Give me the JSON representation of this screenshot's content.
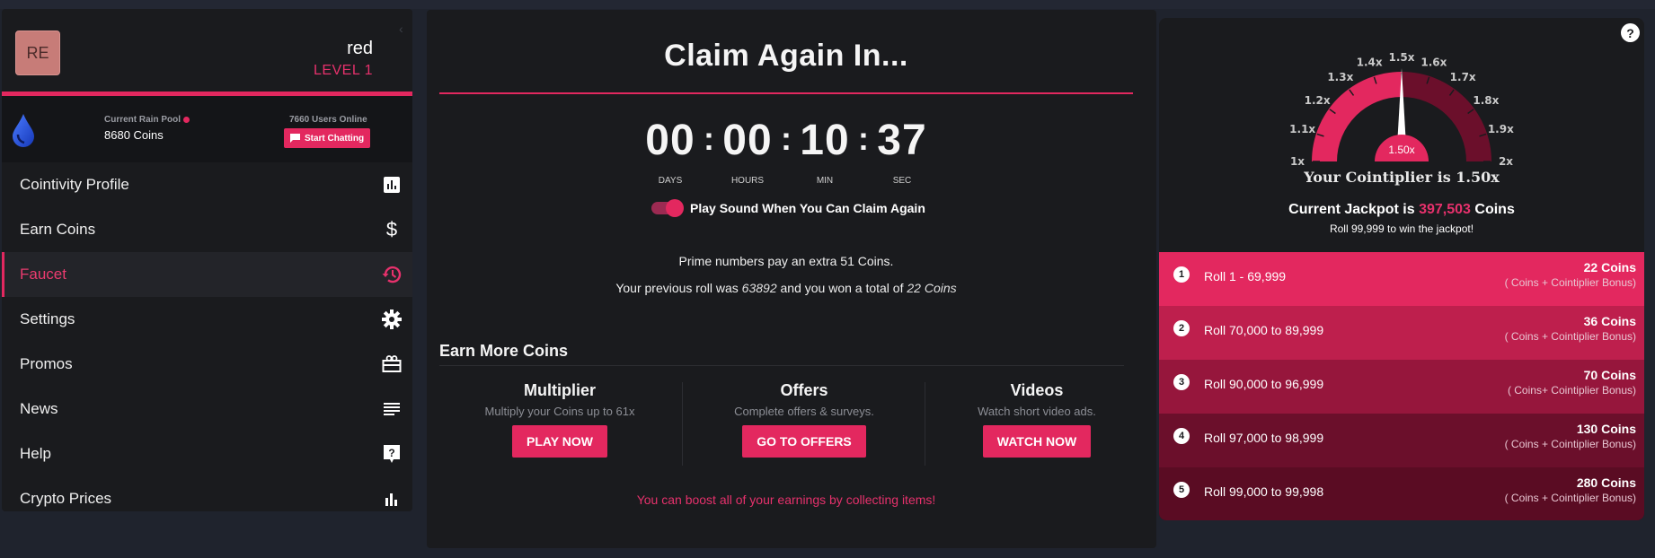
{
  "user": {
    "initials": "RE",
    "name": "red",
    "level": "LEVEL 1"
  },
  "rain": {
    "pool_label": "Current Rain Pool",
    "pool_value": "8680 Coins",
    "online_label": "7660 Users Online",
    "chat_button": "Start Chatting"
  },
  "sidebar": {
    "items": [
      {
        "label": "Cointivity Profile",
        "icon": "bar-chart-icon"
      },
      {
        "label": "Earn Coins",
        "icon": "dollar-icon"
      },
      {
        "label": "Faucet",
        "icon": "history-icon",
        "active": true
      },
      {
        "label": "Settings",
        "icon": "gear-icon"
      },
      {
        "label": "Promos",
        "icon": "gift-icon"
      },
      {
        "label": "News",
        "icon": "news-icon"
      },
      {
        "label": "Help",
        "icon": "help-icon"
      },
      {
        "label": "Crypto Prices",
        "icon": "chart-icon"
      }
    ]
  },
  "claim": {
    "title": "Claim Again In...",
    "timer": {
      "days": "00",
      "hours": "00",
      "min": "10",
      "sec": "37",
      "days_label": "DAYS",
      "hours_label": "HOURS",
      "min_label": "MIN",
      "sec_label": "SEC"
    },
    "sound_label": "Play Sound When You Can Claim Again",
    "prime_text": "Prime numbers pay an extra 51 Coins.",
    "prev_prefix": "Your previous roll was",
    "prev_roll": "63892",
    "prev_mid": "and you won a total of",
    "prev_won": "22 Coins"
  },
  "earn": {
    "title": "Earn More Coins",
    "offers": [
      {
        "title": "Multiplier",
        "desc": "Multiply your Coins up to 61x",
        "button": "PLAY NOW"
      },
      {
        "title": "Offers",
        "desc": "Complete offers & surveys.",
        "button": "GO TO OFFERS"
      },
      {
        "title": "Videos",
        "desc": "Watch short video ads.",
        "button": "WATCH NOW"
      }
    ],
    "boost_text": "You can boost all of your earnings by collecting items!"
  },
  "jackpot": {
    "gauge_ticks": [
      "1x",
      "1.1x",
      "1.2x",
      "1.3x",
      "1.4x",
      "1.5x",
      "1.6x",
      "1.7x",
      "1.8x",
      "1.9x",
      "2x"
    ],
    "gauge_value": "1.50x",
    "gauge_level": 0.5,
    "cointiplier_text": "Your Cointiplier is 1.50x",
    "prefix": "Current Jackpot is",
    "amount": "397,503",
    "suffix": "Coins",
    "sub": "Roll 99,999 to win the jackpot!",
    "help": "?"
  },
  "rolls": [
    {
      "num": "1",
      "label": "Roll 1 - 69,999",
      "coins": "22 Coins",
      "bonus": "( Coins + Cointiplier Bonus)",
      "color": "#e3285f"
    },
    {
      "num": "2",
      "label": "Roll 70,000 to 89,999",
      "coins": "36 Coins",
      "bonus": "( Coins + Cointiplier Bonus)",
      "color": "#be1f4d"
    },
    {
      "num": "3",
      "label": "Roll 90,000 to 96,999",
      "coins": "70 Coins",
      "bonus": "( Coins+ Cointiplier Bonus)",
      "color": "#96163c"
    },
    {
      "num": "4",
      "label": "Roll 97,000 to 98,999",
      "coins": "130 Coins",
      "bonus": "( Coins + Cointiplier Bonus)",
      "color": "#6b0f2b"
    },
    {
      "num": "5",
      "label": "Roll 99,000 to 99,998",
      "coins": "280 Coins",
      "bonus": "( Coins + Cointiplier Bonus)",
      "color": "#5a0c23"
    }
  ],
  "colors": {
    "accent": "#e3285f",
    "panel": "#1a1b1e",
    "background": "#1f232d"
  }
}
